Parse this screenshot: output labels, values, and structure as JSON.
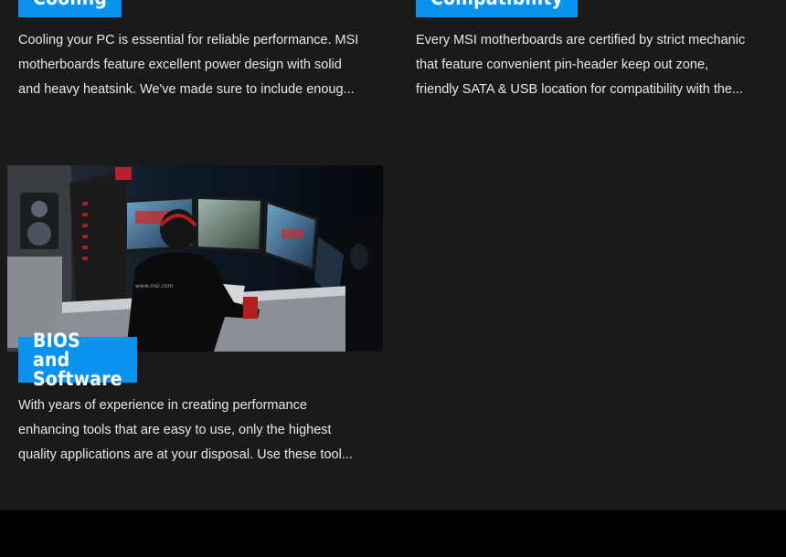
{
  "cards": [
    {
      "title": "Cooling",
      "desc_lines": [
        "Cooling your PC is essential for reliable performance. MSI",
        "motherboards feature excellent power design with solid",
        "and heavy heatsink. We've made sure to include enoug..."
      ]
    },
    {
      "title": "Compatibility",
      "desc_lines": [
        "Every MSI motherboards are certified by strict mechanic",
        "that feature convenient pin-header keep out zone,",
        "friendly SATA & USB location for compatibility with the..."
      ]
    },
    {
      "title": "BIOS and Software",
      "image_watermark": "www.msi.com",
      "desc_lines": [
        "With years of experience in creating performance",
        "enhancing tools that are easy to use, only the highest",
        "quality applications are at your disposal. Use these tool..."
      ]
    }
  ]
}
